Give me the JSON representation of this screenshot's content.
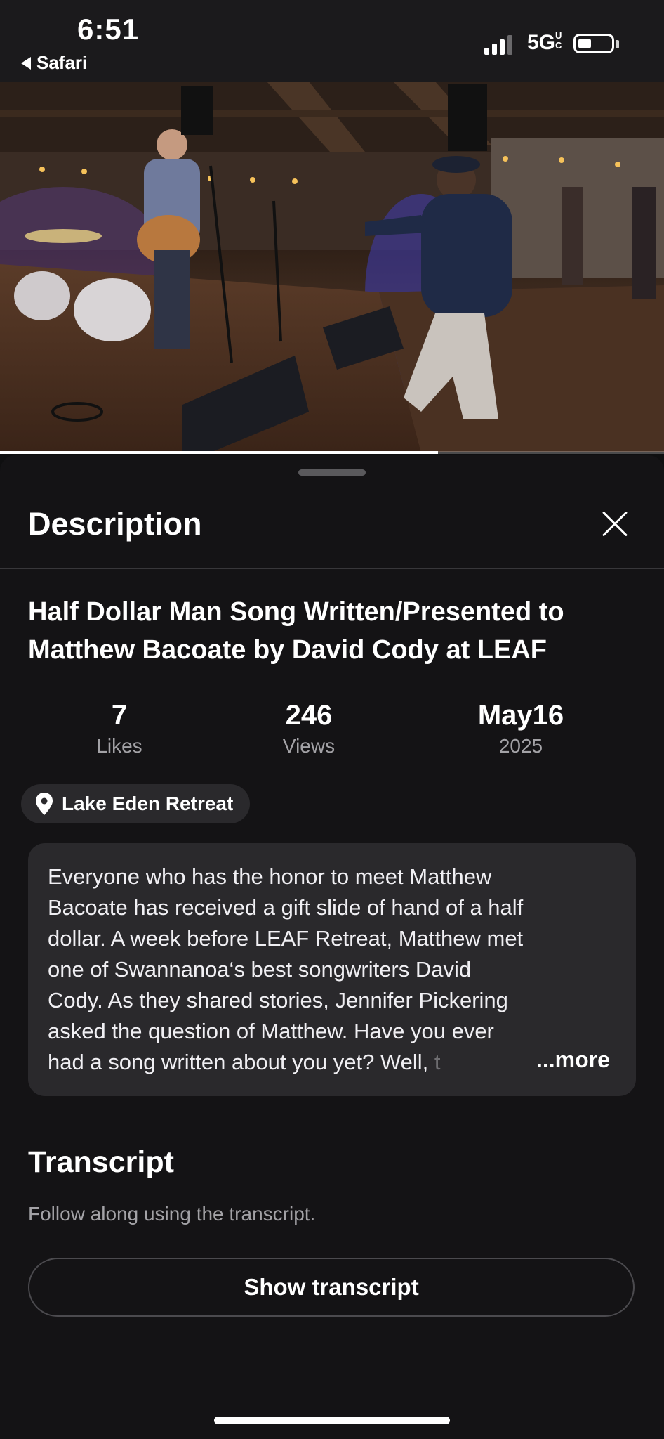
{
  "status_bar": {
    "time": "6:51",
    "back_app": "Safari",
    "network": "5G",
    "network_superscript": "UC",
    "battery_level": 0.4
  },
  "video": {
    "progress": 0.66
  },
  "sheet": {
    "title": "Description",
    "video_title": "Half Dollar Man Song Written/Presented to Matthew Bacoate by David Cody at LEAF",
    "stats": [
      {
        "value": "7",
        "label": "Likes"
      },
      {
        "value": "246",
        "label": "Views"
      },
      {
        "value": "May16",
        "label": "2025"
      }
    ],
    "location": "Lake Eden Retreat",
    "description_lines": [
      "Everyone who has the honor to meet Matthew",
      "Bacoate has received a gift slide of hand of a half",
      "dollar. A week before LEAF Retreat, Matthew met",
      "one of Swannanoa‘s best songwriters David",
      "Cody. As they shared stories, Jennifer Pickering",
      "asked the question of Matthew. Have you ever",
      "had a song written about you yet? Well, "
    ],
    "description_fade": "t",
    "more_label": "...more",
    "transcript": {
      "title": "Transcript",
      "subtitle": "Follow along using the transcript.",
      "button_label": "Show transcript"
    }
  },
  "colors": {
    "sheet_background": "#141315",
    "card_background": "#2a292c",
    "secondary_text": "#a3a2a6"
  }
}
